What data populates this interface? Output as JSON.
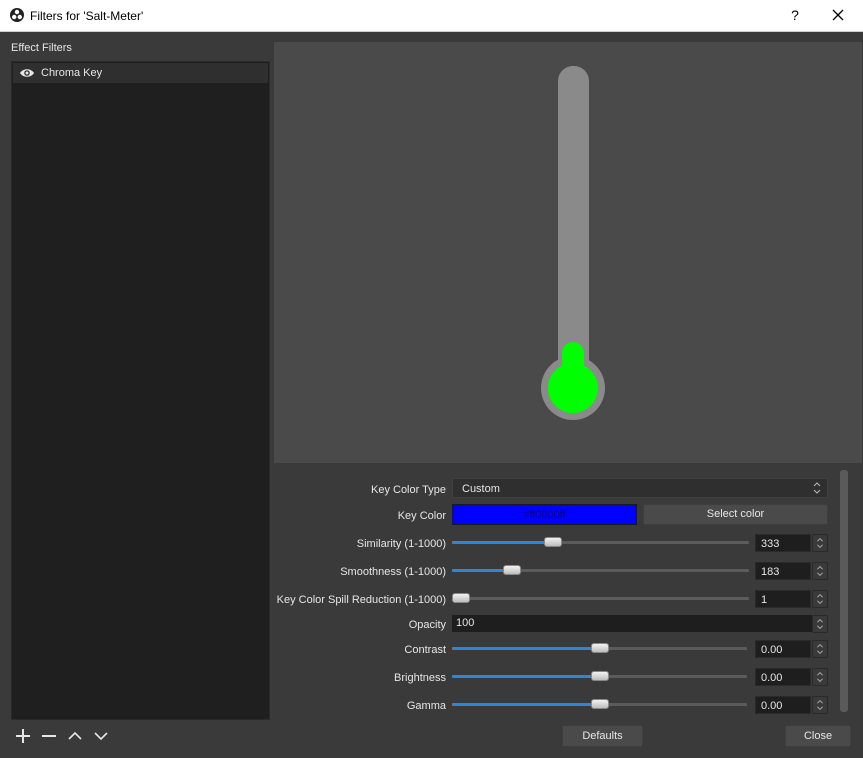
{
  "window": {
    "title": "Filters for 'Salt-Meter'",
    "help_label": "?"
  },
  "left": {
    "section_label": "Effect Filters",
    "filters": [
      {
        "name": "Chroma Key",
        "visible": true
      }
    ],
    "actions": [
      "add-icon",
      "remove-icon",
      "move-up-icon",
      "move-down-icon"
    ]
  },
  "preview": {
    "thermometer_tube_color": "#8a8a8a",
    "thermometer_fluid_color": "#00ff00"
  },
  "properties": {
    "key_color_type": {
      "label": "Key Color Type",
      "value": "Custom"
    },
    "key_color": {
      "label": "Key Color",
      "value": "#ff0000ff",
      "swatch": "#0000ff",
      "select_label": "Select color"
    },
    "similarity": {
      "label": "Similarity (1-1000)",
      "value": "333",
      "fraction": 0.333
    },
    "smoothness": {
      "label": "Smoothness (1-1000)",
      "value": "183",
      "fraction": 0.183
    },
    "spill": {
      "label": "Key Color Spill Reduction (1-1000)",
      "value": "1",
      "fraction": 0.0
    },
    "opacity": {
      "label": "Opacity",
      "value": "100"
    },
    "contrast": {
      "label": "Contrast",
      "value": "0.00",
      "fraction": 0.5
    },
    "brightness": {
      "label": "Brightness",
      "value": "0.00",
      "fraction": 0.5
    },
    "gamma": {
      "label": "Gamma",
      "value": "0.00",
      "fraction": 0.5
    }
  },
  "footer": {
    "defaults_label": "Defaults",
    "close_label": "Close"
  },
  "colors": {
    "accent": "#2e87d6",
    "background": "#3a3a3a"
  }
}
